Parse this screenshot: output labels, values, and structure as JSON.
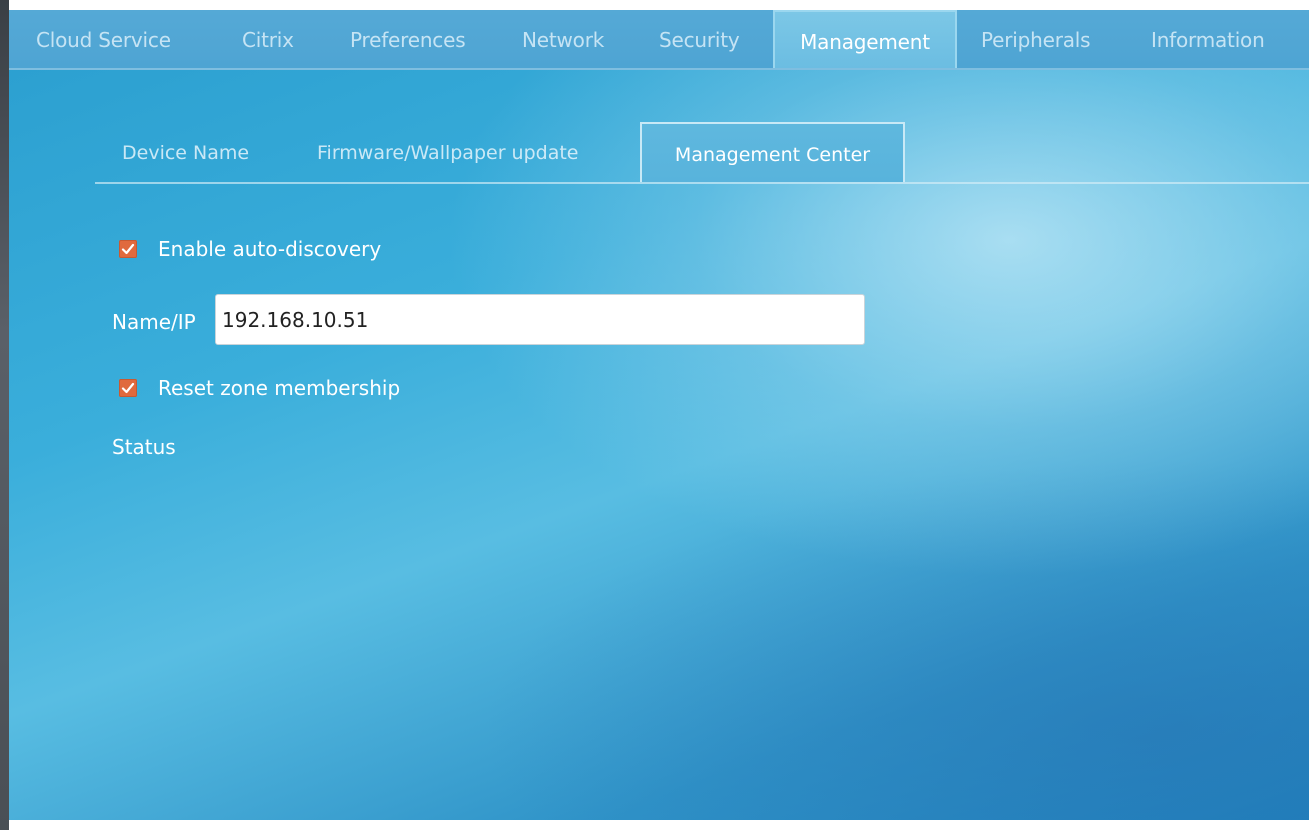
{
  "top_tabs": [
    {
      "label": "Cloud Service",
      "active": false
    },
    {
      "label": "Citrix",
      "active": false
    },
    {
      "label": "Preferences",
      "active": false
    },
    {
      "label": "Network",
      "active": false
    },
    {
      "label": "Security",
      "active": false
    },
    {
      "label": "Management",
      "active": true
    },
    {
      "label": "Peripherals",
      "active": false
    },
    {
      "label": "Information",
      "active": false
    }
  ],
  "sub_tabs": [
    {
      "label": "Device Name",
      "active": false
    },
    {
      "label": "Firmware/Wallpaper update",
      "active": false
    },
    {
      "label": "Management Center",
      "active": true
    }
  ],
  "form": {
    "auto_discovery": {
      "label": "Enable auto-discovery",
      "checked": true
    },
    "name_ip": {
      "label": "Name/IP",
      "value": "192.168.10.51"
    },
    "reset_zone": {
      "label": "Reset zone membership",
      "checked": true
    },
    "status_label": "Status"
  },
  "colors": {
    "panel_blue": "#3aaedb",
    "checkbox_orange": "#e06a3e",
    "active_tab": "#7cc7e6"
  }
}
